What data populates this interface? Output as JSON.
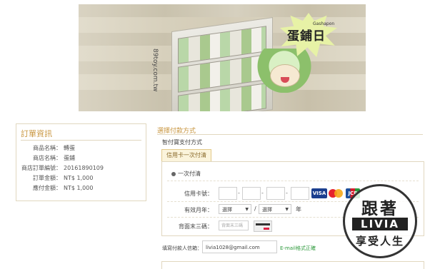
{
  "banner": {
    "badge_text": "蛋鋪日",
    "badge_sub": "Gashapon",
    "side_text": "89toy.com.tw"
  },
  "order": {
    "title": "訂單資訊",
    "rows": [
      {
        "label": "商品名稱：",
        "value": "轉蛋"
      },
      {
        "label": "商店名稱：",
        "value": "蛋鋪"
      },
      {
        "label": "商店訂單編號：",
        "value": "20161890109"
      },
      {
        "label": "訂單金額：",
        "value": "NT$ 1,000"
      },
      {
        "label": "應付金額：",
        "value": "NT$ 1,000"
      }
    ]
  },
  "payment": {
    "title": "選擇付款方式",
    "subtitle": "智付寶支付方式",
    "tab_label": "信用卡一次付清",
    "radio_label": "一次付清",
    "card_number_label": "信用卡號：",
    "expiry_label": "有效月年：",
    "month_placeholder": "選擇",
    "year_placeholder": "選擇",
    "slash": "/",
    "year_unit": "年",
    "cvv_label": "背面末三碼：",
    "cvv_placeholder": "背面末三碼",
    "card_brands": [
      "VISA",
      "MasterCard",
      "JCB"
    ],
    "email_label": "填寫付款人信箱：",
    "email_value": "livia1028@gmail.com",
    "email_status": "E-mail格式正確"
  },
  "watermark": {
    "top": "跟著",
    "middle": "LIVIA",
    "bottom": "享受人生"
  },
  "colors": {
    "accent": "#c8953e",
    "border": "#e1d7bf",
    "success": "#2e9a3c"
  }
}
